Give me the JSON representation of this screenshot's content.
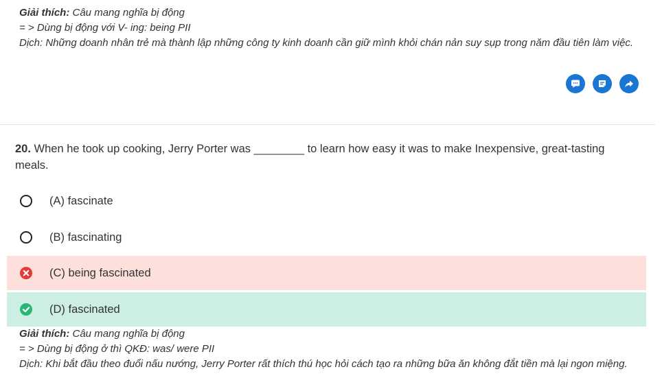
{
  "prev_explanation": {
    "label": "Giải thích:",
    "text": " Câu mang nghĩa bị động",
    "line2": "= > Dùng bị động với V- ing: being PII",
    "line3": "Dịch: Những doanh nhân trẻ mà thành lập những công ty kinh doanh cần giữ mình khỏi chán nản suy sụp trong năm đầu tiên làm việc."
  },
  "actions": {
    "comment_icon": "comment-icon",
    "note_icon": "note-icon",
    "share_icon": "share-icon",
    "color": "#1976d2"
  },
  "question": {
    "number": "20.",
    "text": " When he took up cooking, Jerry Porter was ________ to learn how easy it was to make Inexpensive, great-tasting meals."
  },
  "options": [
    {
      "label": "(A) fascinate",
      "state": "unselected"
    },
    {
      "label": "(B) fascinating",
      "state": "unselected"
    },
    {
      "label": "(C) being fascinated",
      "state": "wrong"
    },
    {
      "label": "(D) fascinated",
      "state": "correct"
    }
  ],
  "explanation": {
    "label": "Giải thích:",
    "text": " Câu mang nghĩa bị động",
    "line2": "= > Dùng bị động ở thì QKĐ: was/ were PII",
    "line3": "Dịch: Khi bắt đầu theo đuổi nấu nướng, Jerry Porter rất thích thú học hỏi cách tạo ra những bữa ăn không đắt tiền mà lại ngon miệng."
  },
  "colors": {
    "wrong_bg": "#fde0dc",
    "wrong_icon": "#e53935",
    "correct_bg": "#cdeee2",
    "correct_icon": "#2bb673"
  }
}
